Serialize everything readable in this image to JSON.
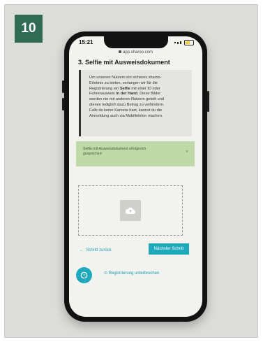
{
  "step_badge": "10",
  "status_bar": {
    "time": "15:21"
  },
  "browser": {
    "url": "app.sharoo.com"
  },
  "page": {
    "title": "3. Selfie mit Ausweisdokument",
    "info": {
      "line1": "Um unseren Nutzern ein sicheres sharoo-",
      "line2": "Erlebnis zu bieten, verlangen wir für die",
      "line3_pre": "Registrierung ein ",
      "line3_bold": "Selfie",
      "line3_post": " mit einer ID oder",
      "line4_pre": "Führerausweis ",
      "line4_bold": "in der Hand",
      "line4_post": ". Diese Bilder",
      "line5": "werden nie mit anderen Nutzern geteilt und",
      "line6": "dienen lediglich dazu Betrug zu verhindern.",
      "line7": "Falls du keine Kamera hast, kannst du die",
      "line8": "Anmeldung auch via Mobiltelefon machen."
    },
    "success": {
      "line1": "Selfie mit Ausweisdokument erfolgreich",
      "line2": "gespeichert",
      "close": "×"
    },
    "back_label": "Schritt zurück",
    "next_label": "Nächster Schritt",
    "pause_label": "Registrierung unterbrechen"
  },
  "colors": {
    "accent": "#1fa9bd",
    "badge": "#2f6b55",
    "success_bg": "#bfd9a8"
  }
}
